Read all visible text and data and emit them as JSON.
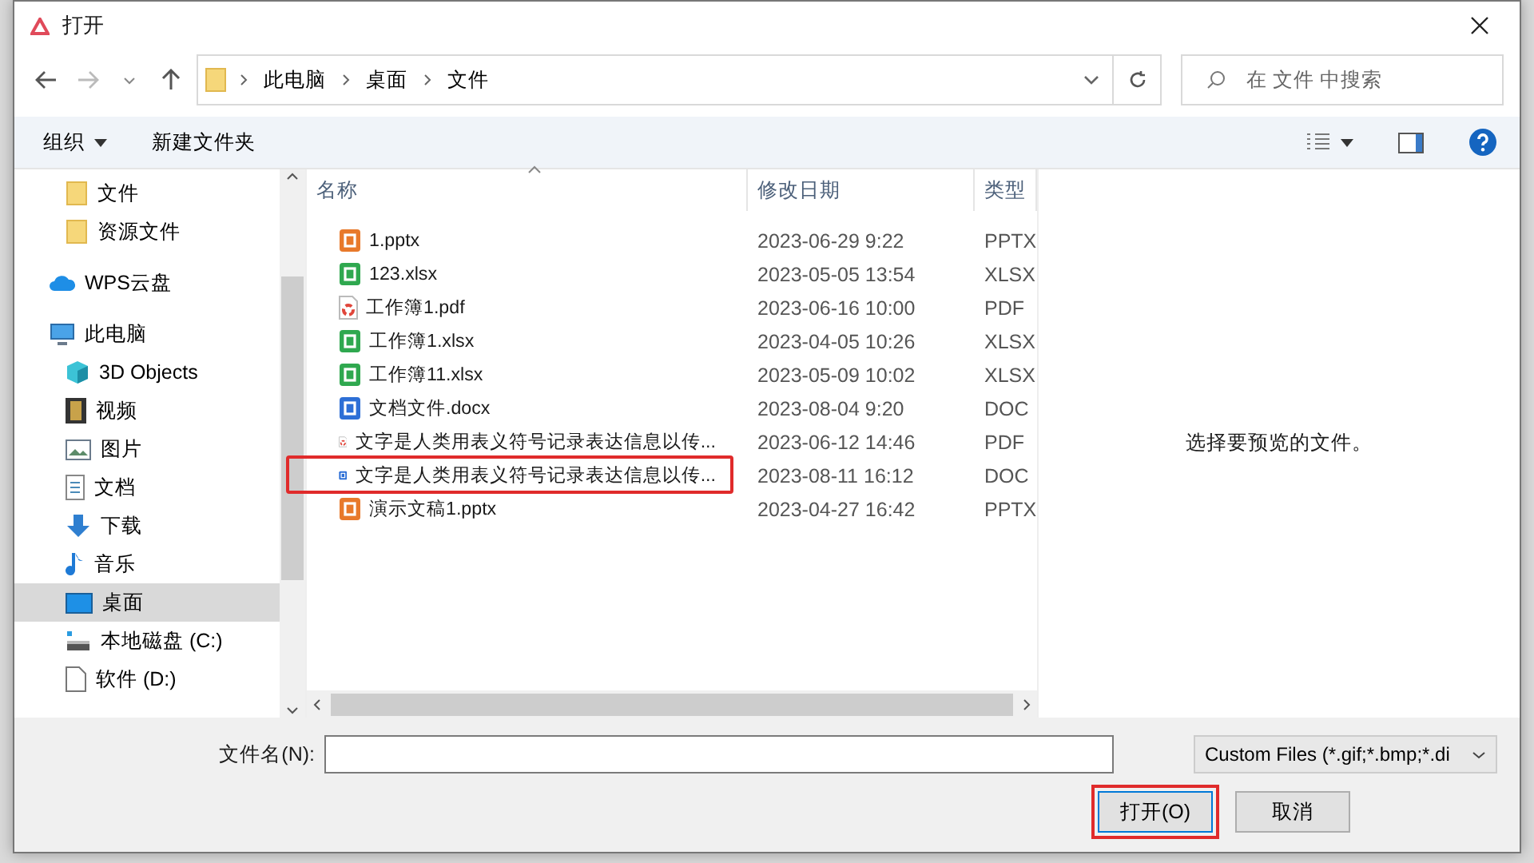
{
  "window": {
    "title": "打开"
  },
  "address": {
    "crumbs": [
      "此电脑",
      "桌面",
      "文件"
    ]
  },
  "search": {
    "placeholder": "在 文件 中搜索"
  },
  "toolbar": {
    "organize": "组织",
    "new_folder": "新建文件夹"
  },
  "sidebar": {
    "items": [
      {
        "children": [
          {
            "label": "文件",
            "kind": "folder",
            "selected": false
          },
          {
            "label": "资源文件",
            "kind": "folder",
            "selected": false
          }
        ]
      },
      {
        "label": "WPS云盘",
        "kind": "cloud",
        "selected": false
      },
      {
        "label": "此电脑",
        "kind": "pc",
        "selected": false,
        "children": [
          {
            "label": "3D Objects",
            "kind": "cube",
            "selected": false
          },
          {
            "label": "视频",
            "kind": "film",
            "selected": false
          },
          {
            "label": "图片",
            "kind": "image",
            "selected": false
          },
          {
            "label": "文档",
            "kind": "doc",
            "selected": false
          },
          {
            "label": "下载",
            "kind": "download",
            "selected": false
          },
          {
            "label": "音乐",
            "kind": "music",
            "selected": false
          },
          {
            "label": "桌面",
            "kind": "desktop",
            "selected": true
          },
          {
            "label": "本地磁盘 (C:)",
            "kind": "drive",
            "selected": false
          },
          {
            "label": "软件 (D:)",
            "kind": "page",
            "selected": false
          }
        ]
      }
    ]
  },
  "table": {
    "columns": [
      "名称",
      "修改日期",
      "类型"
    ],
    "rows": [
      {
        "name": "1.pptx",
        "date": "2023-06-29 9:22",
        "type": "PPTX",
        "kind": "pptx",
        "highlighted": false
      },
      {
        "name": "123.xlsx",
        "date": "2023-05-05 13:54",
        "type": "XLSX",
        "kind": "xlsx",
        "highlighted": false
      },
      {
        "name": "工作簿1.pdf",
        "date": "2023-06-16 10:00",
        "type": "PDF",
        "kind": "pdf",
        "highlighted": false
      },
      {
        "name": "工作簿1.xlsx",
        "date": "2023-04-05 10:26",
        "type": "XLSX",
        "kind": "xlsx",
        "highlighted": false
      },
      {
        "name": "工作簿11.xlsx",
        "date": "2023-05-09 10:02",
        "type": "XLSX",
        "kind": "xlsx",
        "highlighted": false
      },
      {
        "name": "文档文件.docx",
        "date": "2023-08-04 9:20",
        "type": "DOC",
        "kind": "docx",
        "highlighted": false
      },
      {
        "name": "文字是人类用表义符号记录表达信息以传...",
        "date": "2023-06-12 14:46",
        "type": "PDF",
        "kind": "pdf",
        "highlighted": false
      },
      {
        "name": "文字是人类用表义符号记录表达信息以传...",
        "date": "2023-08-11 16:12",
        "type": "DOC",
        "kind": "docx",
        "highlighted": true
      },
      {
        "name": "演示文稿1.pptx",
        "date": "2023-04-27 16:42",
        "type": "PPTX",
        "kind": "pptx",
        "highlighted": false
      }
    ]
  },
  "preview": {
    "message": "选择要预览的文件。"
  },
  "footer": {
    "filename_label": "文件名(N):",
    "filter": "Custom Files (*.gif;*.bmp;*.di",
    "buttons": [
      {
        "label": "打开(O)",
        "highlighted": true
      },
      {
        "label": "取消",
        "highlighted": false
      }
    ]
  }
}
